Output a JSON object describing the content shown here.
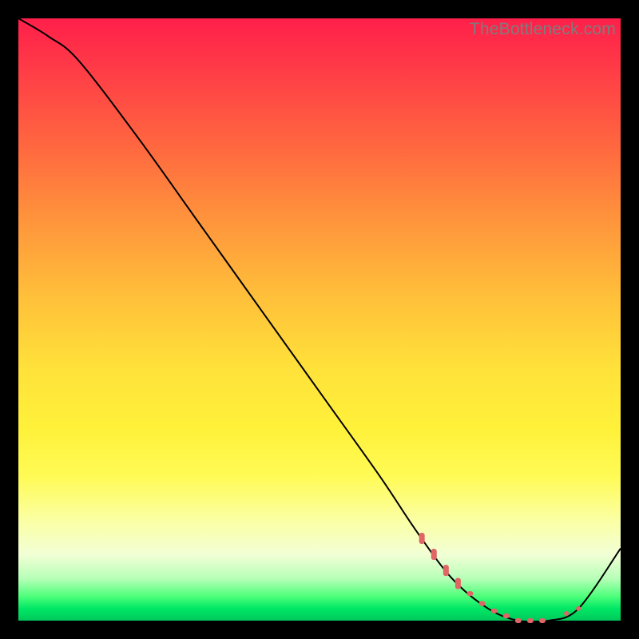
{
  "watermark": "TheBottleneck.com",
  "chart_data": {
    "type": "line",
    "title": "",
    "xlabel": "",
    "ylabel": "",
    "xlim": [
      0,
      1
    ],
    "ylim": [
      0,
      1
    ],
    "series": [
      {
        "name": "curve",
        "x": [
          0.0,
          0.05,
          0.1,
          0.2,
          0.3,
          0.4,
          0.5,
          0.6,
          0.66,
          0.72,
          0.78,
          0.83,
          0.88,
          0.93,
          1.0
        ],
        "y": [
          1.0,
          0.97,
          0.93,
          0.8,
          0.66,
          0.52,
          0.38,
          0.24,
          0.15,
          0.07,
          0.02,
          0.0,
          0.0,
          0.02,
          0.12
        ]
      }
    ],
    "dotted_range_x": [
      0.67,
      0.93
    ],
    "dotted_range_y_approx": 0.01
  }
}
